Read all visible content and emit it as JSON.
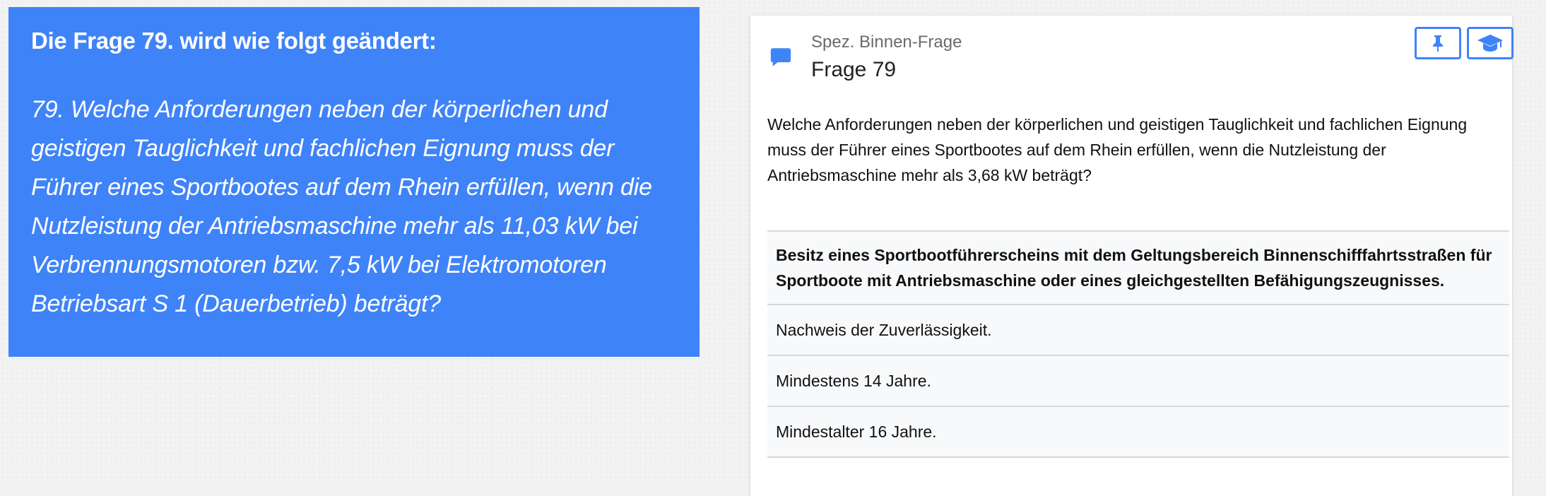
{
  "notice": {
    "title": "Die Frage 79. wird wie folgt geändert:",
    "body": "79. Welche Anforderungen neben der körperlichen und geistigen Tauglichkeit und fachlichen Eignung muss der Führer eines Sportbootes auf dem Rhein erfüllen, wenn die Nutzleistung der Antriebsmaschine mehr als 11,03 kW bei Verbrennungsmotoren bzw. 7,5 kW bei Elektromotoren Betriebsart S 1 (Dauerbetrieb) beträgt?"
  },
  "card": {
    "category": "Spez. Binnen-Frage",
    "title": "Frage 79",
    "icons": {
      "header": "chat-bubble-icon",
      "pin": "pin-icon",
      "learn": "graduation-cap-icon"
    },
    "accent_color": "#3f83f8",
    "question": "Welche Anforderungen neben der körperlichen und geistigen Tauglichkeit und fachlichen Eignung muss der Führer eines Sportbootes auf dem Rhein erfüllen, wenn die Nutzleistung der Antriebsmaschine mehr als 3,68 kW beträgt?",
    "answers": [
      "Besitz eines Sportbootführerscheins mit dem Geltungsbereich Binnenschifffahrtsstraßen für Sportboote mit Antriebsmaschine oder eines gleichgestellten Befähigungszeugnisses.",
      "Nachweis der Zuverlässigkeit.",
      "Mindestens 14 Jahre.",
      "Mindestalter 16 Jahre."
    ]
  }
}
